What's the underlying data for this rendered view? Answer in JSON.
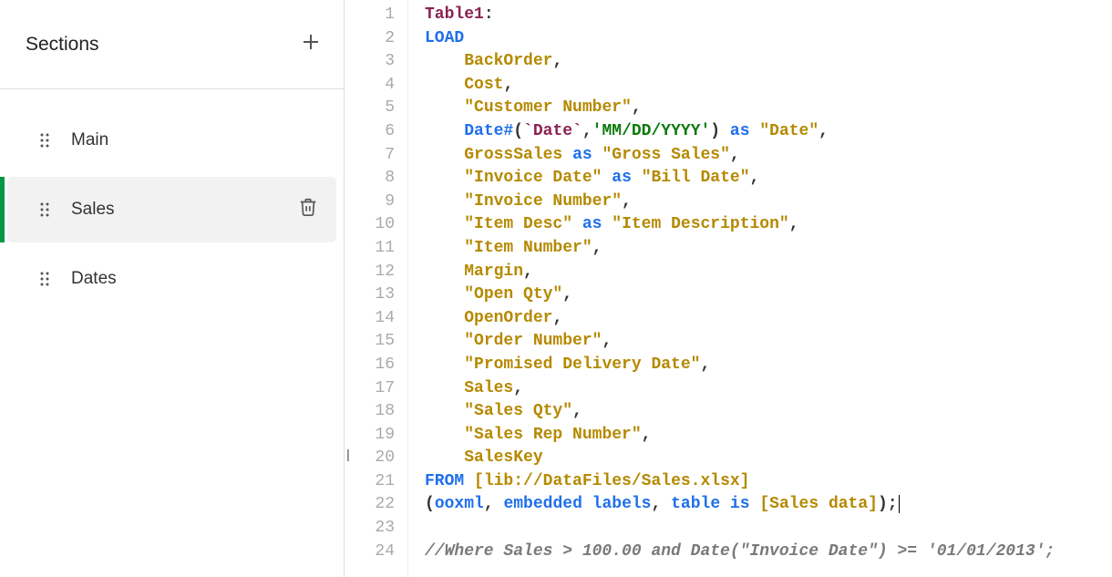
{
  "sidebar": {
    "title": "Sections",
    "items": [
      {
        "label": "Main",
        "active": false
      },
      {
        "label": "Sales",
        "active": true
      },
      {
        "label": "Dates",
        "active": false
      }
    ]
  },
  "editor": {
    "line_count": 24,
    "code_lines": [
      [
        {
          "t": "Table1",
          "c": "tk-table"
        },
        {
          "t": ":",
          "c": "tk-punct"
        }
      ],
      [
        {
          "t": "LOAD",
          "c": "tk-kw"
        }
      ],
      [
        {
          "t": "    ",
          "c": ""
        },
        {
          "t": "BackOrder",
          "c": "tk-field"
        },
        {
          "t": ",",
          "c": "tk-punct"
        }
      ],
      [
        {
          "t": "    ",
          "c": ""
        },
        {
          "t": "Cost",
          "c": "tk-field"
        },
        {
          "t": ",",
          "c": "tk-punct"
        }
      ],
      [
        {
          "t": "    ",
          "c": ""
        },
        {
          "t": "\"Customer Number\"",
          "c": "tk-field"
        },
        {
          "t": ",",
          "c": "tk-punct"
        }
      ],
      [
        {
          "t": "    ",
          "c": ""
        },
        {
          "t": "Date#",
          "c": "tk-func"
        },
        {
          "t": "(",
          "c": "tk-punct"
        },
        {
          "t": "`Date`",
          "c": "tk-bt"
        },
        {
          "t": ",",
          "c": "tk-punct"
        },
        {
          "t": "'MM/DD/YYYY'",
          "c": "tk-str"
        },
        {
          "t": ")",
          "c": "tk-punct"
        },
        {
          "t": " ",
          "c": ""
        },
        {
          "t": "as",
          "c": "tk-kw"
        },
        {
          "t": " ",
          "c": ""
        },
        {
          "t": "\"Date\"",
          "c": "tk-field"
        },
        {
          "t": ",",
          "c": "tk-punct"
        }
      ],
      [
        {
          "t": "    ",
          "c": ""
        },
        {
          "t": "GrossSales",
          "c": "tk-field"
        },
        {
          "t": " ",
          "c": ""
        },
        {
          "t": "as",
          "c": "tk-kw"
        },
        {
          "t": " ",
          "c": ""
        },
        {
          "t": "\"Gross Sales\"",
          "c": "tk-field"
        },
        {
          "t": ",",
          "c": "tk-punct"
        }
      ],
      [
        {
          "t": "    ",
          "c": ""
        },
        {
          "t": "\"Invoice Date\"",
          "c": "tk-field"
        },
        {
          "t": " ",
          "c": ""
        },
        {
          "t": "as",
          "c": "tk-kw"
        },
        {
          "t": " ",
          "c": ""
        },
        {
          "t": "\"Bill Date\"",
          "c": "tk-field"
        },
        {
          "t": ",",
          "c": "tk-punct"
        }
      ],
      [
        {
          "t": "    ",
          "c": ""
        },
        {
          "t": "\"Invoice Number\"",
          "c": "tk-field"
        },
        {
          "t": ",",
          "c": "tk-punct"
        }
      ],
      [
        {
          "t": "    ",
          "c": ""
        },
        {
          "t": "\"Item Desc\"",
          "c": "tk-field"
        },
        {
          "t": " ",
          "c": ""
        },
        {
          "t": "as",
          "c": "tk-kw"
        },
        {
          "t": " ",
          "c": ""
        },
        {
          "t": "\"Item Description\"",
          "c": "tk-field"
        },
        {
          "t": ",",
          "c": "tk-punct"
        }
      ],
      [
        {
          "t": "    ",
          "c": ""
        },
        {
          "t": "\"Item Number\"",
          "c": "tk-field"
        },
        {
          "t": ",",
          "c": "tk-punct"
        }
      ],
      [
        {
          "t": "    ",
          "c": ""
        },
        {
          "t": "Margin",
          "c": "tk-field"
        },
        {
          "t": ",",
          "c": "tk-punct"
        }
      ],
      [
        {
          "t": "    ",
          "c": ""
        },
        {
          "t": "\"Open Qty\"",
          "c": "tk-field"
        },
        {
          "t": ",",
          "c": "tk-punct"
        }
      ],
      [
        {
          "t": "    ",
          "c": ""
        },
        {
          "t": "OpenOrder",
          "c": "tk-field"
        },
        {
          "t": ",",
          "c": "tk-punct"
        }
      ],
      [
        {
          "t": "    ",
          "c": ""
        },
        {
          "t": "\"Order Number\"",
          "c": "tk-field"
        },
        {
          "t": ",",
          "c": "tk-punct"
        }
      ],
      [
        {
          "t": "    ",
          "c": ""
        },
        {
          "t": "\"Promised Delivery Date\"",
          "c": "tk-field"
        },
        {
          "t": ",",
          "c": "tk-punct"
        }
      ],
      [
        {
          "t": "    ",
          "c": ""
        },
        {
          "t": "Sales",
          "c": "tk-field"
        },
        {
          "t": ",",
          "c": "tk-punct"
        }
      ],
      [
        {
          "t": "    ",
          "c": ""
        },
        {
          "t": "\"Sales Qty\"",
          "c": "tk-field"
        },
        {
          "t": ",",
          "c": "tk-punct"
        }
      ],
      [
        {
          "t": "    ",
          "c": ""
        },
        {
          "t": "\"Sales Rep Number\"",
          "c": "tk-field"
        },
        {
          "t": ",",
          "c": "tk-punct"
        }
      ],
      [
        {
          "t": "    ",
          "c": ""
        },
        {
          "t": "SalesKey",
          "c": "tk-field"
        }
      ],
      [
        {
          "t": "FROM",
          "c": "tk-kw"
        },
        {
          "t": " ",
          "c": ""
        },
        {
          "t": "[lib://DataFiles/Sales.xlsx]",
          "c": "tk-field"
        }
      ],
      [
        {
          "t": "(",
          "c": "tk-punct"
        },
        {
          "t": "ooxml",
          "c": "tk-kw"
        },
        {
          "t": ",",
          "c": "tk-punct"
        },
        {
          "t": " ",
          "c": ""
        },
        {
          "t": "embedded labels",
          "c": "tk-kw"
        },
        {
          "t": ",",
          "c": "tk-punct"
        },
        {
          "t": " ",
          "c": ""
        },
        {
          "t": "table is",
          "c": "tk-kw"
        },
        {
          "t": " ",
          "c": ""
        },
        {
          "t": "[Sales data]",
          "c": "tk-field"
        },
        {
          "t": ");",
          "c": "tk-punct"
        },
        {
          "t": "",
          "c": "",
          "cursor": true
        }
      ],
      [],
      [
        {
          "t": "//Where Sales > 100.00 and Date(\"Invoice Date\") >= '01/01/2013';",
          "c": "tk-comment"
        }
      ]
    ]
  }
}
